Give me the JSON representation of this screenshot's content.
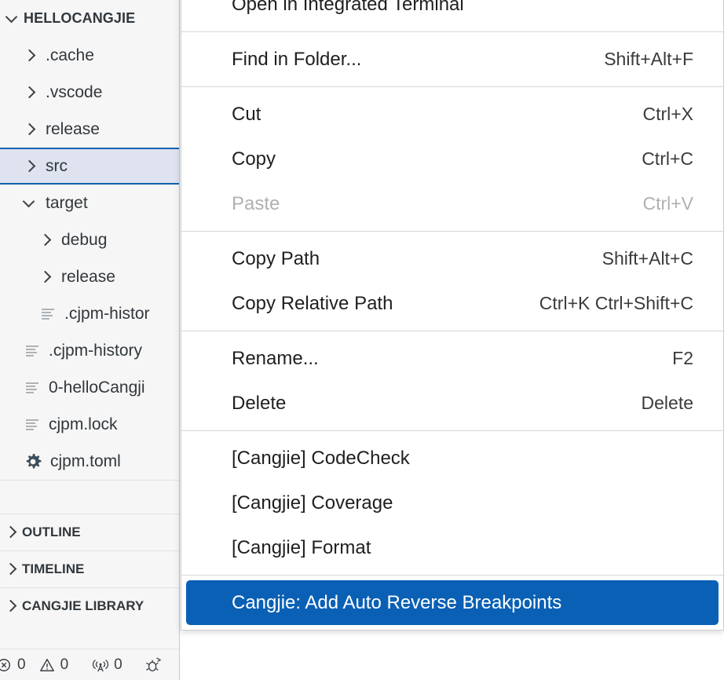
{
  "sidebar": {
    "project": {
      "name": "HELLOCANGJIE",
      "expander": "chevron-down-icon"
    },
    "tree": [
      {
        "label": ".cache",
        "kind": "folder",
        "state": "collapsed",
        "depth": 1
      },
      {
        "label": ".vscode",
        "kind": "folder",
        "state": "collapsed",
        "depth": 1
      },
      {
        "label": "release",
        "kind": "folder",
        "state": "collapsed",
        "depth": 1
      },
      {
        "label": "src",
        "kind": "folder",
        "state": "collapsed",
        "depth": 1,
        "selected": true
      },
      {
        "label": "target",
        "kind": "folder",
        "state": "expanded",
        "depth": 1
      },
      {
        "label": "debug",
        "kind": "folder",
        "state": "collapsed",
        "depth": 2
      },
      {
        "label": "release",
        "kind": "folder",
        "state": "collapsed",
        "depth": 2
      },
      {
        "label": ".cjpm-histor",
        "kind": "file",
        "depth": 2,
        "truncated": true
      },
      {
        "label": ".cjpm-history",
        "kind": "file",
        "depth": 1,
        "truncated": true
      },
      {
        "label": "0-helloCangji",
        "kind": "file",
        "depth": 1,
        "truncated": true
      },
      {
        "label": "cjpm.lock",
        "kind": "file",
        "depth": 1
      },
      {
        "label": "cjpm.toml",
        "kind": "gear",
        "depth": 1
      }
    ],
    "sections": [
      {
        "label": "OUTLINE",
        "state": "collapsed"
      },
      {
        "label": "TIMELINE",
        "state": "collapsed"
      },
      {
        "label": "CANGJIE LIBRARY",
        "state": "collapsed",
        "truncated": true
      }
    ],
    "statusbar": {
      "error_icon": "error-circle-icon",
      "error_count": "0",
      "warning_icon": "warning-triangle-icon",
      "warning_count": "0",
      "radio_icon": "radio-tower-icon",
      "radio_count": "0",
      "debug_icon": "bug-icon"
    }
  },
  "context_menu": {
    "groups": [
      {
        "items": [
          {
            "label": "Open in Integrated Terminal",
            "shortcut": ""
          }
        ]
      },
      {
        "items": [
          {
            "label": "Find in Folder...",
            "shortcut": "Shift+Alt+F"
          }
        ]
      },
      {
        "items": [
          {
            "label": "Cut",
            "shortcut": "Ctrl+X"
          },
          {
            "label": "Copy",
            "shortcut": "Ctrl+C"
          },
          {
            "label": "Paste",
            "shortcut": "Ctrl+V",
            "disabled": true
          }
        ]
      },
      {
        "items": [
          {
            "label": "Copy Path",
            "shortcut": "Shift+Alt+C"
          },
          {
            "label": "Copy Relative Path",
            "shortcut": "Ctrl+K Ctrl+Shift+C"
          }
        ]
      },
      {
        "items": [
          {
            "label": "Rename...",
            "shortcut": "F2"
          },
          {
            "label": "Delete",
            "shortcut": "Delete"
          }
        ]
      },
      {
        "items": [
          {
            "label": "[Cangjie] CodeCheck",
            "shortcut": ""
          },
          {
            "label": "[Cangjie] Coverage",
            "shortcut": ""
          },
          {
            "label": "[Cangjie] Format",
            "shortcut": ""
          }
        ]
      },
      {
        "items": [
          {
            "label": "Cangjie: Add Auto Reverse Breakpoints",
            "shortcut": "",
            "highlighted": true
          }
        ]
      }
    ]
  },
  "colors": {
    "menu_highlight": "#0a60b5",
    "selection_bg": "#dee3ef",
    "selection_border": "#0e63ad",
    "sidebar_bg": "#f6f6f6",
    "menu_bg": "#ffffff",
    "text": "#31373c",
    "disabled_text": "#b0b0b0"
  }
}
